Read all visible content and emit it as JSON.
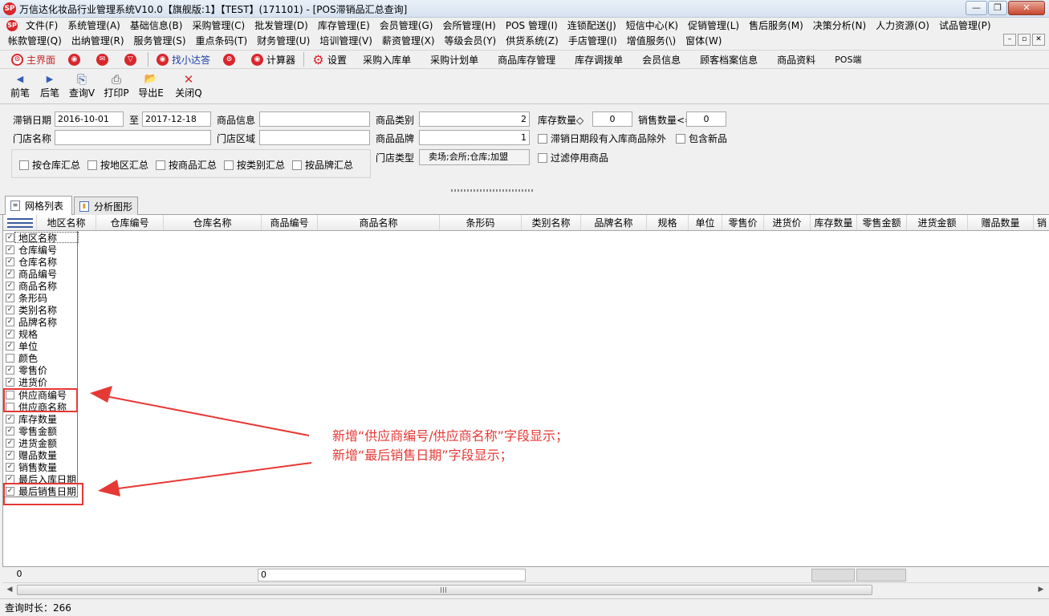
{
  "window": {
    "logo_text": "SP",
    "title": "万信达化妆品行业管理系统V10.0【旗舰版:1】【TEST】(171101) - [POS滞销品汇总查询]",
    "minimize_glyph": "—",
    "restore_glyph": "❐",
    "close_glyph": "✕"
  },
  "menu": {
    "row1": [
      "文件(F)",
      "系统管理(A)",
      "基础信息(B)",
      "采购管理(C)",
      "批发管理(D)",
      "库存管理(E)",
      "会员管理(G)",
      "会所管理(H)",
      "POS 管理(I)",
      "连锁配送(J)",
      "短信中心(K)",
      "促销管理(L)",
      "售后服务(M)",
      "决策分析(N)",
      "人力资源(O)",
      "试品管理(P)"
    ],
    "row2": [
      "帐款管理(Q)",
      "出纳管理(R)",
      "服务管理(S)",
      "重点条码(T)",
      "财务管理(U)",
      "培训管理(V)",
      "薪资管理(X)",
      "等级会员(Y)",
      "供货系统(Z)",
      "手店管理(I)",
      "增值服务(\\)",
      "窗体(W)"
    ],
    "mdi_min": "–",
    "mdi_restore": "▫",
    "mdi_close": "✕"
  },
  "toolbar1": {
    "home": "主界面",
    "icon_glyphs": [
      "⊙",
      "◉",
      "✉",
      "▽"
    ],
    "help": "找小达答",
    "calc": "计算器",
    "settings": "设置",
    "items": [
      "采购入库单",
      "采购计划单",
      "商品库存管理",
      "库存调拨单",
      "会员信息",
      "顾客档案信息",
      "商品资料",
      "POS端"
    ]
  },
  "toolbar2": {
    "prev": "前笔",
    "next": "后笔",
    "query": "查询V",
    "print": "打印P",
    "export": "导出E",
    "close": "关闭Q",
    "prev_glyph": "◀",
    "next_glyph": "▶",
    "query_glyph": "⎘",
    "print_glyph": "⎙",
    "export_glyph": "📂",
    "close_glyph": "✕"
  },
  "filter": {
    "date_label": "滞销日期",
    "date_from": "2016-10-01",
    "date_to_label": "至",
    "date_to": "2017-12-18",
    "product_info_label": "商品信息",
    "product_info": "",
    "category_label": "商品类别",
    "category": "2",
    "stock_label": "库存数量◇",
    "stock_value": "0",
    "sales_label": "销售数量<=",
    "sales_value": "0",
    "store_name_label": "门店名称",
    "store_name": "",
    "store_area_label": "门店区域",
    "store_area": "",
    "brand_label": "商品品牌",
    "brand": "1",
    "exclude_label": "滞销日期段有入库商品除外",
    "include_new_label": "包含新品",
    "store_type_label": "门店类型",
    "store_type": "卖场;会所;仓库;加盟",
    "filter_disabled_label": "过滤停用商品",
    "summary": [
      "按仓库汇总",
      "按地区汇总",
      "按商品汇总",
      "按类别汇总",
      "按品牌汇总"
    ]
  },
  "tabs": [
    "网格列表",
    "分析图形"
  ],
  "tab_icons": [
    "≡",
    "▮"
  ],
  "grid": {
    "columns": [
      "地区名称",
      "仓库编号",
      "仓库名称",
      "商品编号",
      "商品名称",
      "条形码",
      "类别名称",
      "品牌名称",
      "规格",
      "单位",
      "零售价",
      "进货价",
      "库存数量",
      "零售金额",
      "进货金额",
      "赠品数量",
      "销"
    ]
  },
  "column_chooser": {
    "check_glyph": "✓",
    "items": [
      {
        "label": "地区名称",
        "checked": true
      },
      {
        "label": "仓库编号",
        "checked": true
      },
      {
        "label": "仓库名称",
        "checked": true
      },
      {
        "label": "商品编号",
        "checked": true
      },
      {
        "label": "商品名称",
        "checked": true
      },
      {
        "label": "条形码",
        "checked": true
      },
      {
        "label": "类别名称",
        "checked": true
      },
      {
        "label": "品牌名称",
        "checked": true
      },
      {
        "label": "规格",
        "checked": true
      },
      {
        "label": "单位",
        "checked": true
      },
      {
        "label": "颜色",
        "checked": false
      },
      {
        "label": "零售价",
        "checked": true
      },
      {
        "label": "进货价",
        "checked": true
      },
      {
        "label": "供应商编号",
        "checked": false
      },
      {
        "label": "供应商名称",
        "checked": false
      },
      {
        "label": "库存数量",
        "checked": true
      },
      {
        "label": "零售金额",
        "checked": true
      },
      {
        "label": "进货金额",
        "checked": true
      },
      {
        "label": "赠品数量",
        "checked": true
      },
      {
        "label": "销售数量",
        "checked": true
      },
      {
        "label": "最后入库日期",
        "checked": true
      },
      {
        "label": "最后销售日期",
        "checked": true
      }
    ]
  },
  "annotation": {
    "line1": "新增“供应商编号/供应商名称”字段显示；",
    "line2": "新增“最后销售日期”字段显示；",
    "color": "#e53935"
  },
  "footer": {
    "count": "0",
    "sum": "0",
    "scroll_left": "◀",
    "scroll_right": "▶"
  },
  "status": {
    "text": "查询时长：266"
  }
}
